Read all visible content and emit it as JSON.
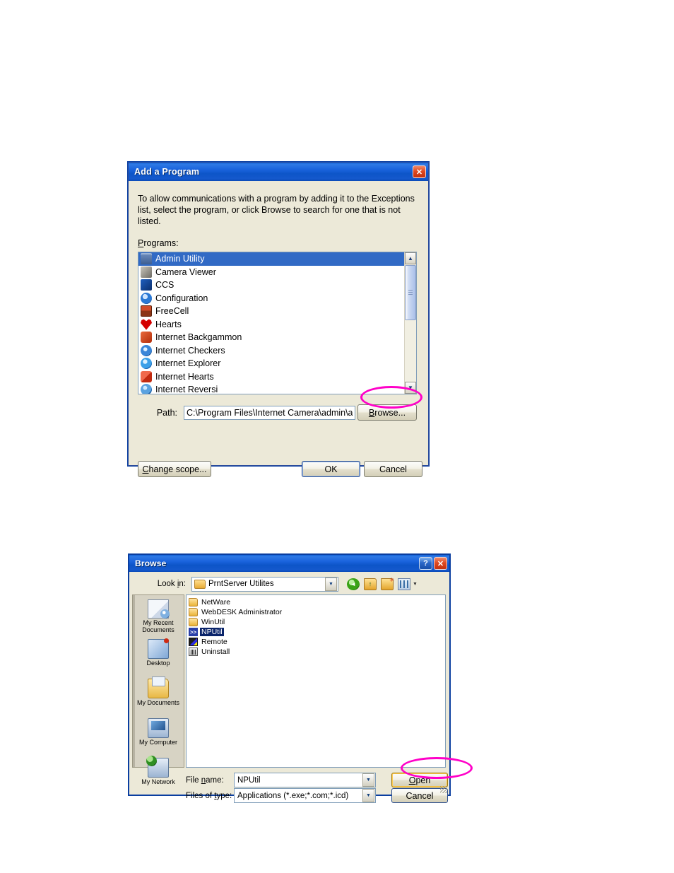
{
  "add_program_dialog": {
    "title": "Add a Program",
    "close_label": "✕",
    "description": "To allow communications with a program by adding it to the Exceptions list, select the program, or click Browse to search for one that is not listed.",
    "programs_label": "Programs:",
    "programs": [
      {
        "name": "Admin Utility",
        "icon": "admin-utility-icon",
        "selected": true
      },
      {
        "name": "Camera Viewer",
        "icon": "camera-viewer-icon",
        "selected": false
      },
      {
        "name": "CCS",
        "icon": "ccs-icon",
        "selected": false
      },
      {
        "name": "Configuration",
        "icon": "configuration-icon",
        "selected": false
      },
      {
        "name": "FreeCell",
        "icon": "freecell-icon",
        "selected": false
      },
      {
        "name": "Hearts",
        "icon": "hearts-icon",
        "selected": false
      },
      {
        "name": "Internet Backgammon",
        "icon": "internet-backgammon-icon",
        "selected": false
      },
      {
        "name": "Internet Checkers",
        "icon": "internet-checkers-icon",
        "selected": false
      },
      {
        "name": "Internet Explorer",
        "icon": "internet-explorer-icon",
        "selected": false
      },
      {
        "name": "Internet Hearts",
        "icon": "internet-hearts-icon",
        "selected": false
      },
      {
        "name": "Internet Reversi",
        "icon": "internet-reversi-icon",
        "selected": false
      }
    ],
    "path_label": "Path:",
    "path_value": "C:\\Program Files\\Internet Camera\\admin\\admi",
    "browse_button": "Browse...",
    "change_scope_button": "Change scope...",
    "ok_button": "OK",
    "cancel_button": "Cancel",
    "scroll_up_glyph": "▲",
    "scroll_down_glyph": "▼"
  },
  "browse_dialog": {
    "title": "Browse",
    "help_label": "?",
    "close_label": "✕",
    "look_in_label": "Look in:",
    "look_in_value": "PrntServer Utilites",
    "toolbar": [
      {
        "name": "back-icon",
        "tooltip": "Back"
      },
      {
        "name": "up-one-level-icon",
        "tooltip": "Up One Level"
      },
      {
        "name": "new-folder-icon",
        "tooltip": "Create New Folder"
      },
      {
        "name": "views-icon",
        "tooltip": "Views"
      }
    ],
    "places": [
      {
        "label": "My Recent Documents",
        "icon": "recent-documents-icon"
      },
      {
        "label": "Desktop",
        "icon": "desktop-icon"
      },
      {
        "label": "My Documents",
        "icon": "my-documents-icon"
      },
      {
        "label": "My Computer",
        "icon": "my-computer-icon"
      },
      {
        "label": "My Network",
        "icon": "my-network-icon"
      }
    ],
    "files": [
      {
        "name": "NetWare",
        "icon": "folder-icon",
        "selected": false
      },
      {
        "name": "WebDESK Administrator",
        "icon": "folder-icon",
        "selected": false
      },
      {
        "name": "WinUtil",
        "icon": "folder-icon",
        "selected": false
      },
      {
        "name": "NPUtil",
        "icon": "nputil-icon",
        "selected": true
      },
      {
        "name": "Remote",
        "icon": "remote-icon",
        "selected": false
      },
      {
        "name": "Uninstall",
        "icon": "uninstall-icon",
        "selected": false
      }
    ],
    "file_name_label": "File name:",
    "file_name_value": "NPUtil",
    "files_of_type_label": "Files of type:",
    "files_of_type_value": "Applications (*.exe;*.com;*.icd)",
    "open_button": "Open",
    "cancel_button": "Cancel",
    "dropdown_glyph": "▼"
  },
  "annotations": {
    "highlight_color": "#ff00c8",
    "highlights": [
      "browse-button",
      "open-button"
    ]
  }
}
